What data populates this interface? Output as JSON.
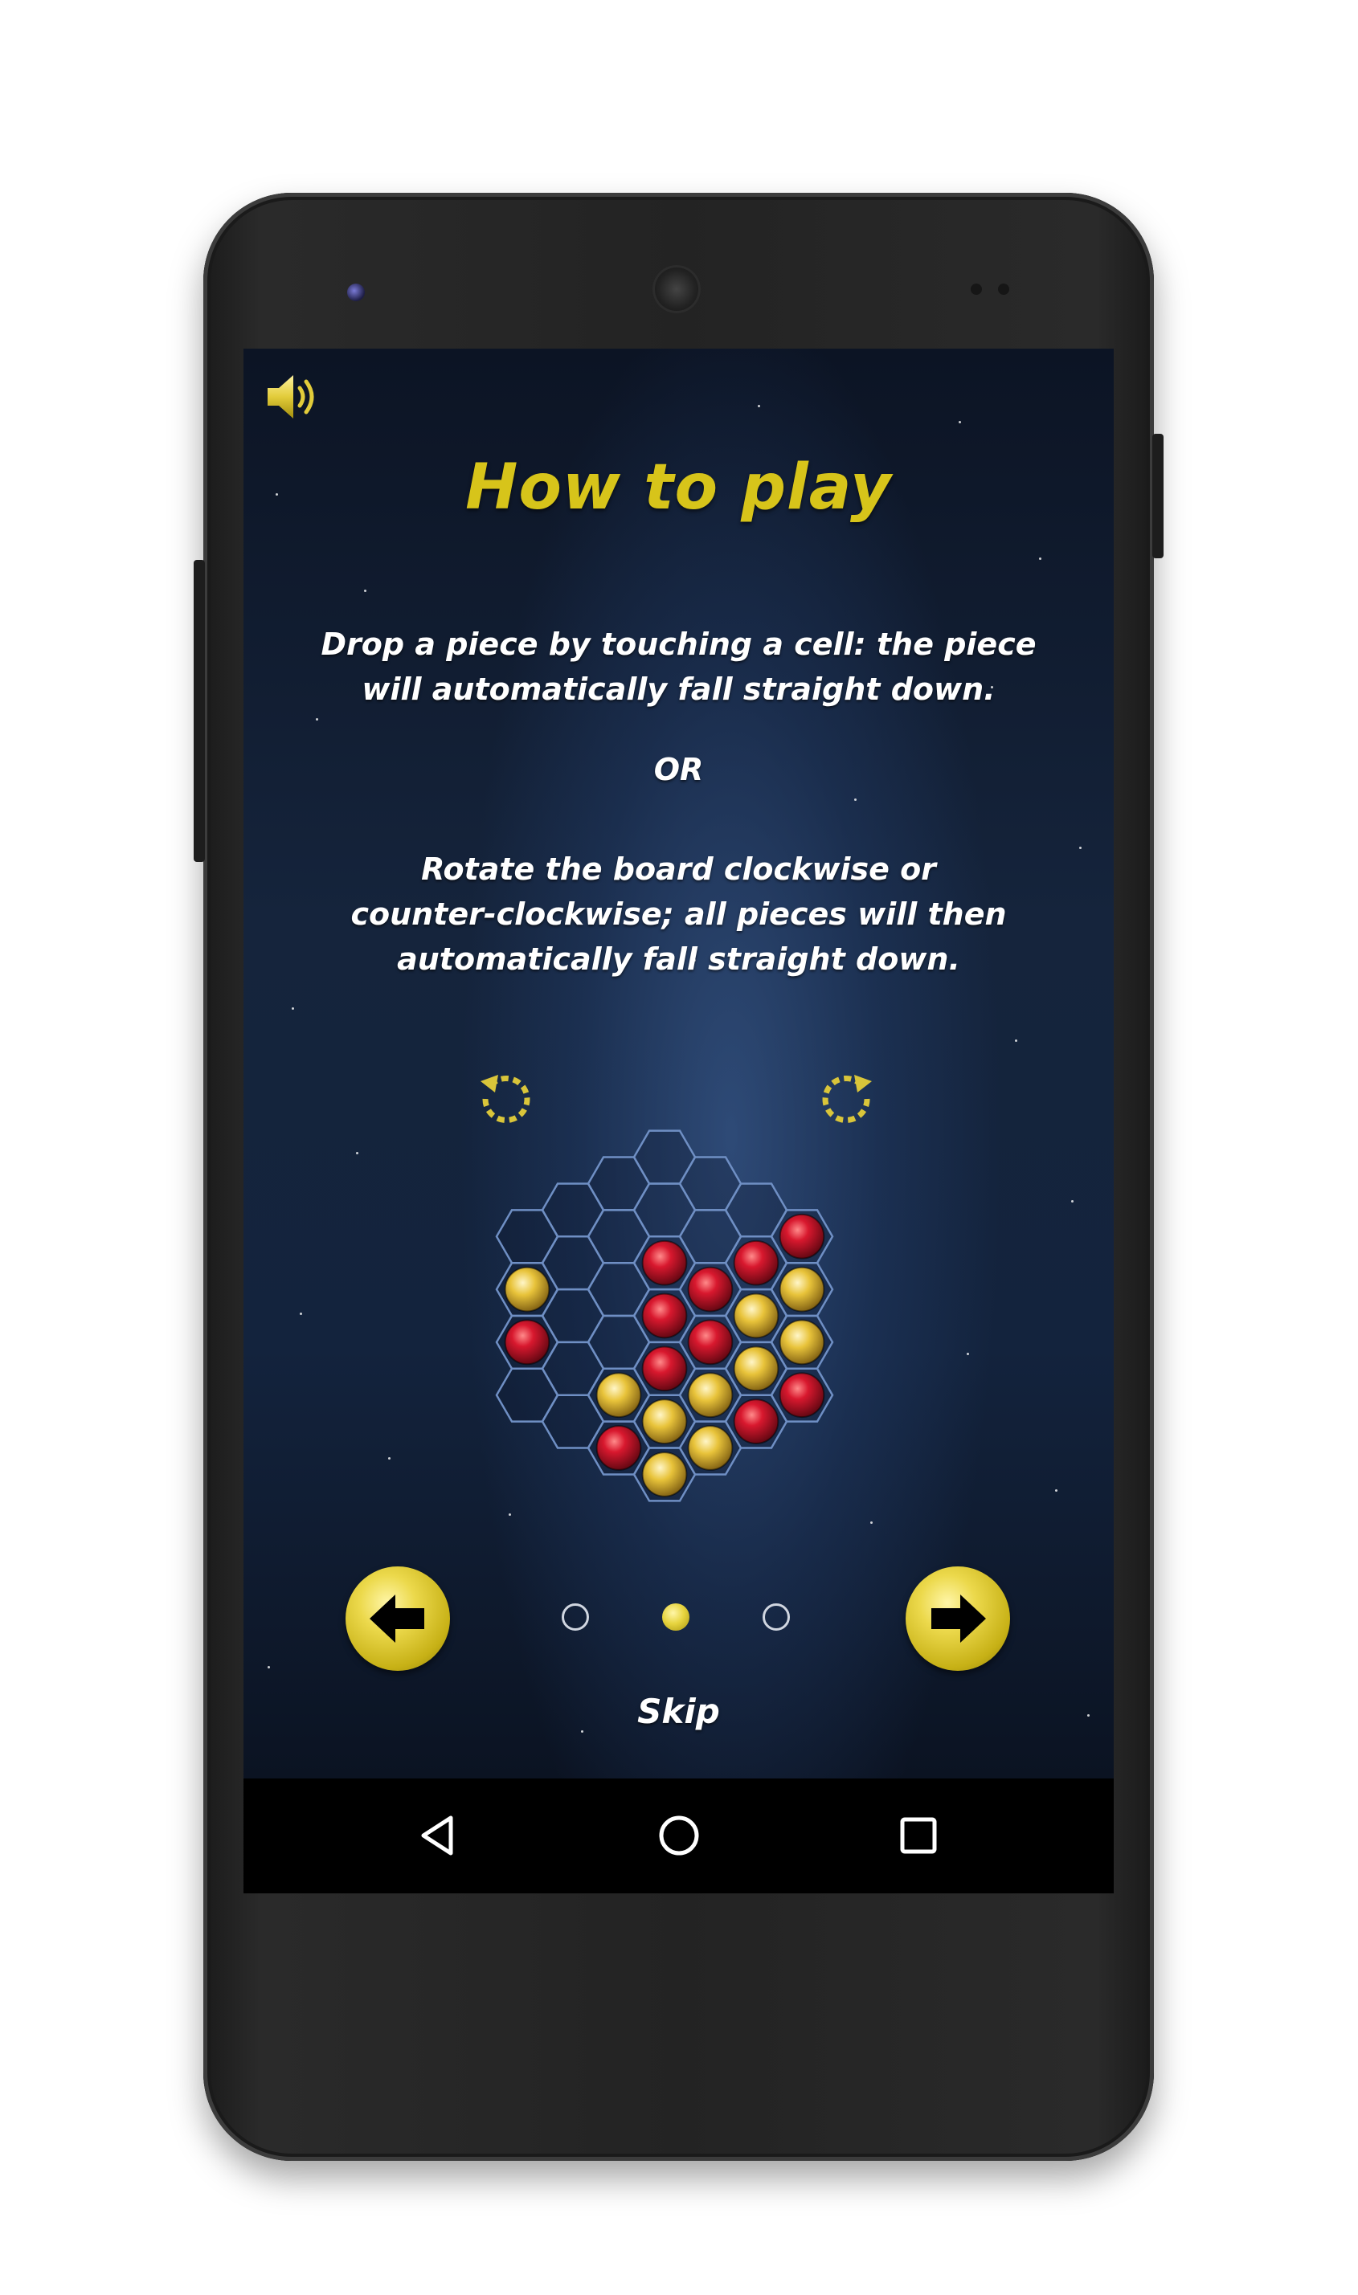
{
  "screen": {
    "title": "How to play",
    "paragraph1": "Drop a piece by touching a cell: the piece\nwill automatically fall straight down.",
    "or_label": "OR",
    "paragraph2": "Rotate the board clockwise or\ncounter-clockwise; all pieces will then\nautomatically fall straight down.",
    "skip_label": "Skip"
  },
  "icons": {
    "sound": "speaker-on-icon",
    "rotate_left": "rotate-counterclockwise-icon",
    "rotate_right": "rotate-clockwise-icon",
    "prev": "arrow-left-icon",
    "next": "arrow-right-icon",
    "nav_back": "back-triangle-icon",
    "nav_home": "home-circle-icon",
    "nav_recents": "recents-square-icon"
  },
  "pager": {
    "pages": 3,
    "current_page": 2
  },
  "board": {
    "shape": "hexagon of hexagonal cells",
    "pieces": {
      "red_count": 11,
      "yellow_count": 10
    }
  },
  "colors": {
    "accent_yellow": "#d7c41a",
    "piece_red": "#d8182e",
    "piece_yellow": "#e8c33a",
    "grid_line": "#6f8fc4",
    "text": "#ffffff"
  }
}
